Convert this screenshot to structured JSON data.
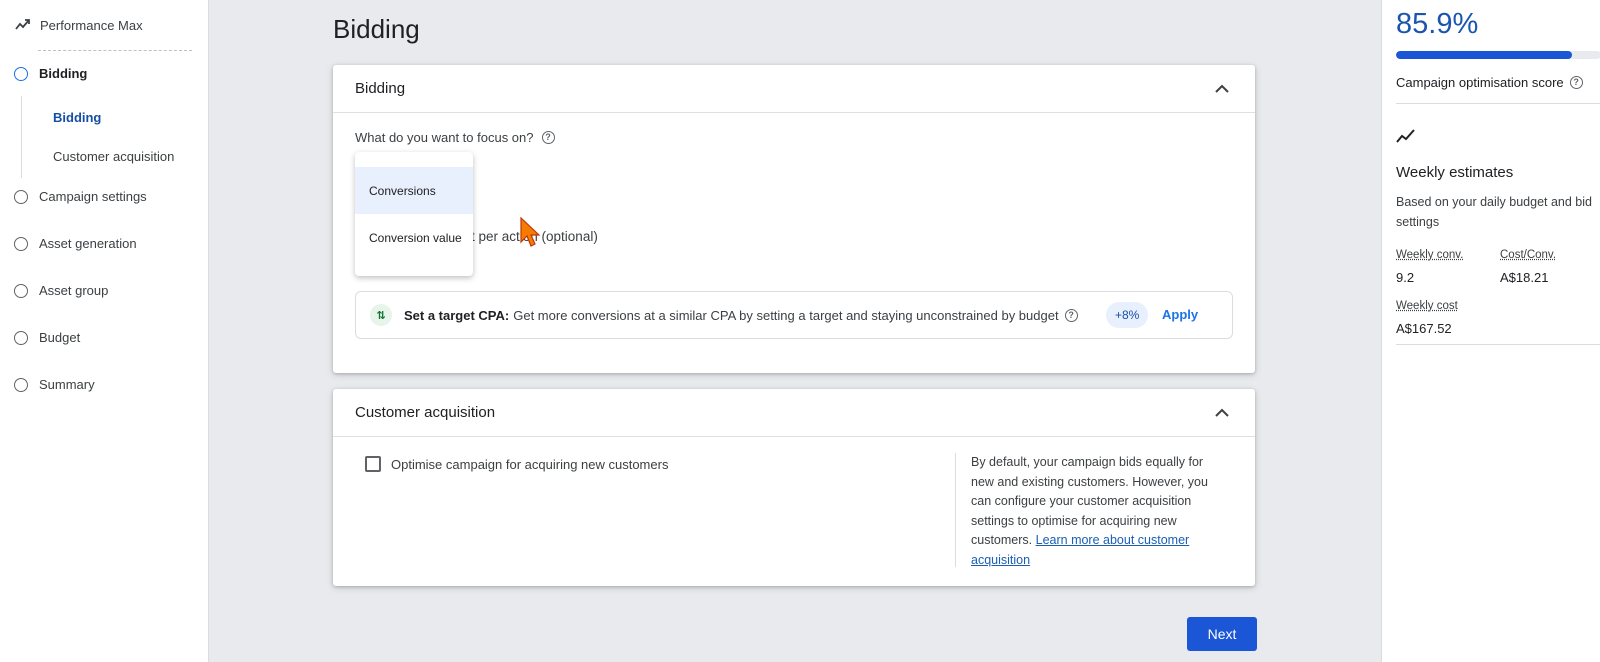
{
  "nav": {
    "top_label": "Performance Max",
    "items": [
      {
        "label": "Bidding"
      },
      {
        "label": "Campaign settings"
      },
      {
        "label": "Asset generation"
      },
      {
        "label": "Asset group"
      },
      {
        "label": "Budget"
      },
      {
        "label": "Summary"
      }
    ],
    "subitems": [
      {
        "label": "Bidding"
      },
      {
        "label": "Customer acquisition"
      }
    ]
  },
  "main": {
    "page_title": "Bidding",
    "bidding_card": {
      "title": "Bidding",
      "question": "What do you want to focus on?",
      "dropdown_options": [
        "Conversions",
        "Conversion value"
      ],
      "behind_text": "t per action (optional)",
      "recommendation": {
        "bold": "Set a target CPA:",
        "text": "Get more conversions at a similar CPA by setting a target and staying unconstrained by budget",
        "badge": "+8%",
        "apply": "Apply"
      }
    },
    "acquisition_card": {
      "title": "Customer acquisition",
      "checkbox_label": "Optimise campaign for acquiring new customers",
      "description": "By default, your campaign bids equally for new and existing customers. However, you can configure your customer acquisition settings to optimise for acquiring new customers.",
      "link": "Learn more about customer acquisition"
    },
    "next_label": "Next"
  },
  "right": {
    "score": "85.9%",
    "score_fraction": 0.859,
    "score_label": "Campaign optimisation score",
    "weekly_title": "Weekly estimates",
    "weekly_desc": "Based on your daily budget and bid settings",
    "stats": [
      {
        "label": "Weekly conv.",
        "value": "9.2"
      },
      {
        "label": "Cost/Conv.",
        "value": "A$18.21"
      },
      {
        "label": "Weekly cost",
        "value": "A$167.52"
      }
    ]
  },
  "colors": {
    "primary": "#1a56d6",
    "selected_option": "#e8f0fe"
  }
}
